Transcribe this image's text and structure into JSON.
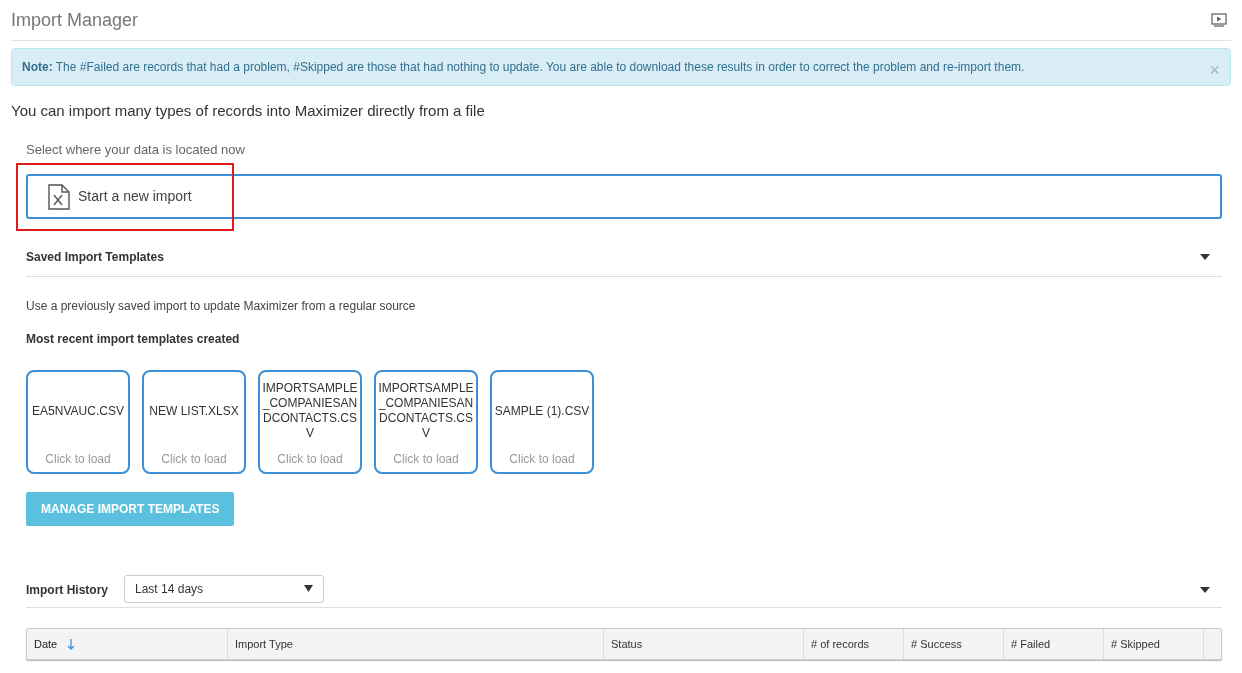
{
  "header": {
    "title": "Import Manager"
  },
  "note": {
    "text": "**Note:** The #Failed are records that had a problem, #Skipped are those that had nothing to update. You are able to download these results in order to correct the problem and re-import them.",
    "close": "×"
  },
  "heading": "You can import many types of records into Maximizer directly from a file",
  "select_label": "Select where your data is located now",
  "new_import": {
    "label": "Start a new import",
    "highlighted": true
  },
  "saved_templates": {
    "title": "Saved Import Templates",
    "expanded": true,
    "description": "Use a previously saved import to update Maximizer from a regular source",
    "recent_title": "Most recent import templates created",
    "templates": [
      {
        "name": "EA5NVAUC.CSV",
        "hint": "Click to load"
      },
      {
        "name": "NEW LIST.XLSX",
        "hint": "Click to load"
      },
      {
        "name": "IMPORTSAMPLE_COMPANIESANDCONTACTS.CSV",
        "hint": "Click to load"
      },
      {
        "name": "IMPORTSAMPLE_COMPANIESANDCONTACTS.CSV",
        "hint": "Click to load"
      },
      {
        "name": "SAMPLE (1).CSV",
        "hint": "Click to load"
      }
    ],
    "manage_button": "MANAGE IMPORT TEMPLATES"
  },
  "import_history": {
    "title": "Import History",
    "period": "Last 14 days",
    "expanded": true,
    "columns": [
      {
        "label": "Date",
        "sorted": true
      },
      {
        "label": "Import Type",
        "sorted": false
      },
      {
        "label": "Status",
        "sorted": false
      },
      {
        "label": "# of records",
        "sorted": false
      },
      {
        "label": "# Success",
        "sorted": false
      },
      {
        "label": "# Failed",
        "sorted": false
      },
      {
        "label": "# Skipped",
        "sorted": false
      }
    ]
  }
}
